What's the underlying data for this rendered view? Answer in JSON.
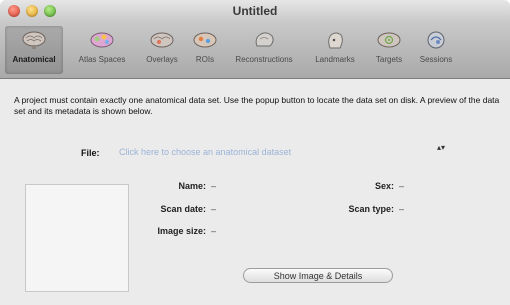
{
  "window": {
    "title": "Untitled"
  },
  "toolbar": {
    "items": [
      {
        "label": "Anatomical",
        "icon": "brain-icon",
        "selected": true
      },
      {
        "label": "Atlas Spaces",
        "icon": "atlas-brain-icon",
        "selected": false
      },
      {
        "label": "Overlays",
        "icon": "overlay-brain-icon",
        "selected": false
      },
      {
        "label": "ROIs",
        "icon": "roi-brain-icon",
        "selected": false
      },
      {
        "label": "Reconstructions",
        "icon": "reconstruction-icon",
        "selected": false
      },
      {
        "label": "Landmarks",
        "icon": "landmark-head-icon",
        "selected": false
      },
      {
        "label": "Targets",
        "icon": "target-brain-icon",
        "selected": false
      },
      {
        "label": "Sessions",
        "icon": "session-head-icon",
        "selected": false
      }
    ]
  },
  "main": {
    "description": "A project must contain exactly one anatomical data set. Use the popup button to locate the data set on disk. A preview of the data set and its metadata is shown below.",
    "file_label": "File:",
    "file_popup_text": "Click here to choose an anatomical dataset",
    "popup_arrows": "▴▾",
    "metadata": {
      "name_label": "Name:",
      "name_value": "–",
      "sex_label": "Sex:",
      "sex_value": "–",
      "scan_date_label": "Scan date:",
      "scan_date_value": "–",
      "scan_type_label": "Scan type:",
      "scan_type_value": "–",
      "image_size_label": "Image size:",
      "image_size_value": "–"
    },
    "show_button_label": "Show Image & Details"
  }
}
